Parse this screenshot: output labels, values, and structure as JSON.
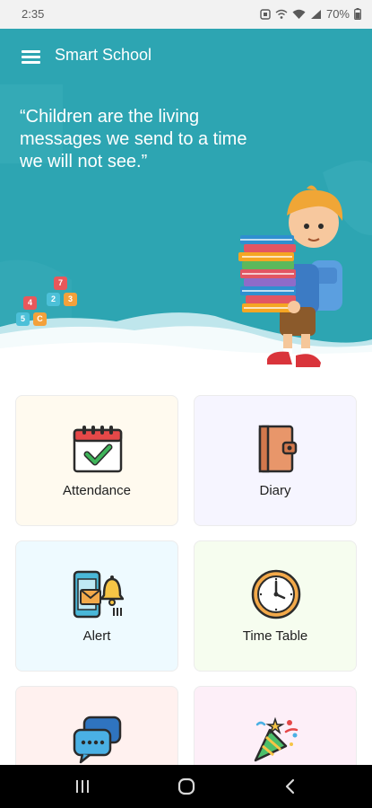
{
  "status_bar": {
    "time": "2:35",
    "battery": "70%",
    "icons": [
      "nfc-icon",
      "wifi-calling-icon",
      "wifi-icon",
      "signal-icon",
      "battery-icon"
    ]
  },
  "header": {
    "title": "Smart School",
    "menu_icon": "hamburger-menu-icon"
  },
  "hero": {
    "quote": "“Children are the living messages we send to a time we will not see.”",
    "cubes": [
      "7",
      "4",
      "2",
      "3",
      "5",
      "C"
    ],
    "background_color": "#2da5b2"
  },
  "tiles": [
    {
      "label": "Attendance",
      "icon": "calendar-check-icon",
      "bg": "#fffaef"
    },
    {
      "label": "Diary",
      "icon": "diary-icon",
      "bg": "#f6f5ff"
    },
    {
      "label": "Alert",
      "icon": "phone-bell-icon",
      "bg": "#eefaff"
    },
    {
      "label": "Time Table",
      "icon": "clock-icon",
      "bg": "#f6fdef"
    },
    {
      "label": "",
      "icon": "chat-bubbles-icon",
      "bg": "#fff1ef"
    },
    {
      "label": "",
      "icon": "party-popper-icon",
      "bg": "#fdeff8"
    }
  ],
  "nav_bar": {
    "buttons": [
      "recent-apps-icon",
      "home-icon",
      "back-icon"
    ]
  }
}
